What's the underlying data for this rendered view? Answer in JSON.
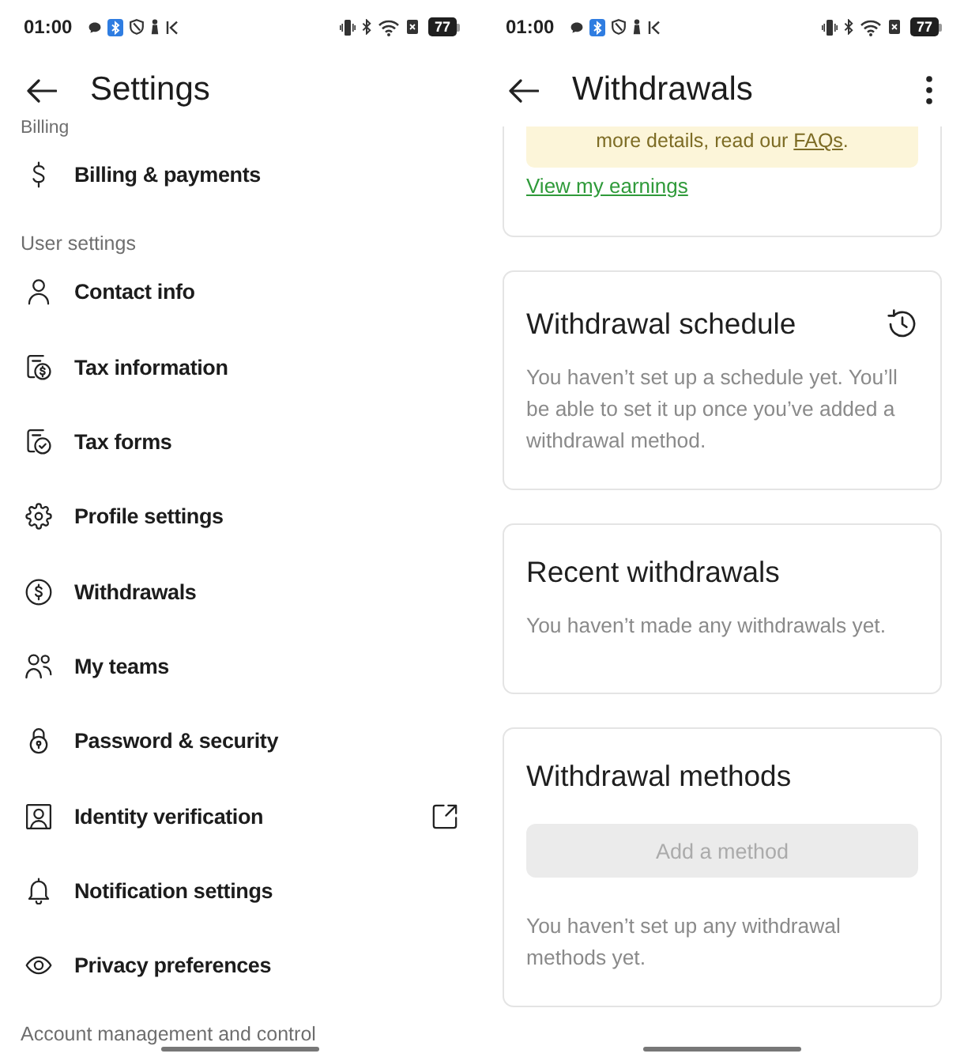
{
  "screens": [
    {
      "kind": "settings",
      "status_bar": {
        "time": "01:00",
        "battery": "77"
      },
      "title": "Settings",
      "sections": [
        {
          "heading": "Billing",
          "items": [
            {
              "label": "Billing & payments",
              "external": false
            }
          ]
        },
        {
          "heading": "User settings",
          "items": [
            {
              "label": "Contact info",
              "external": false
            },
            {
              "label": "Tax information",
              "external": false
            },
            {
              "label": "Tax forms",
              "external": false
            },
            {
              "label": "Profile settings",
              "external": false
            },
            {
              "label": "Withdrawals",
              "external": false
            },
            {
              "label": "My teams",
              "external": false
            },
            {
              "label": "Password & security",
              "external": false
            },
            {
              "label": "Identity verification",
              "external": true
            },
            {
              "label": "Notification settings",
              "external": false
            },
            {
              "label": "Privacy preferences",
              "external": false
            }
          ]
        },
        {
          "heading": "Account management and control"
        }
      ]
    },
    {
      "kind": "withdrawals",
      "status_bar": {
        "time": "01:00",
        "battery": "77"
      },
      "title": "Withdrawals",
      "cards": [
        {
          "kind": "notice",
          "notice": {
            "text": "more details, read our ",
            "link": "FAQs",
            "end": "."
          },
          "link": "View my earnings"
        },
        {
          "kind": "icon",
          "title": "Withdrawal schedule",
          "text": "You haven’t set up a schedule yet. You’ll be able to set it up once you’ve added a withdrawal method."
        },
        {
          "kind": "text",
          "title": "Recent withdrawals",
          "text": "You haven’t made any withdrawals yet."
        },
        {
          "kind": "button",
          "title": "Withdrawal methods",
          "button": {
            "label": "Add a method",
            "disabled": true
          },
          "text": "You haven’t set up any withdrawal methods yet."
        }
      ]
    }
  ]
}
